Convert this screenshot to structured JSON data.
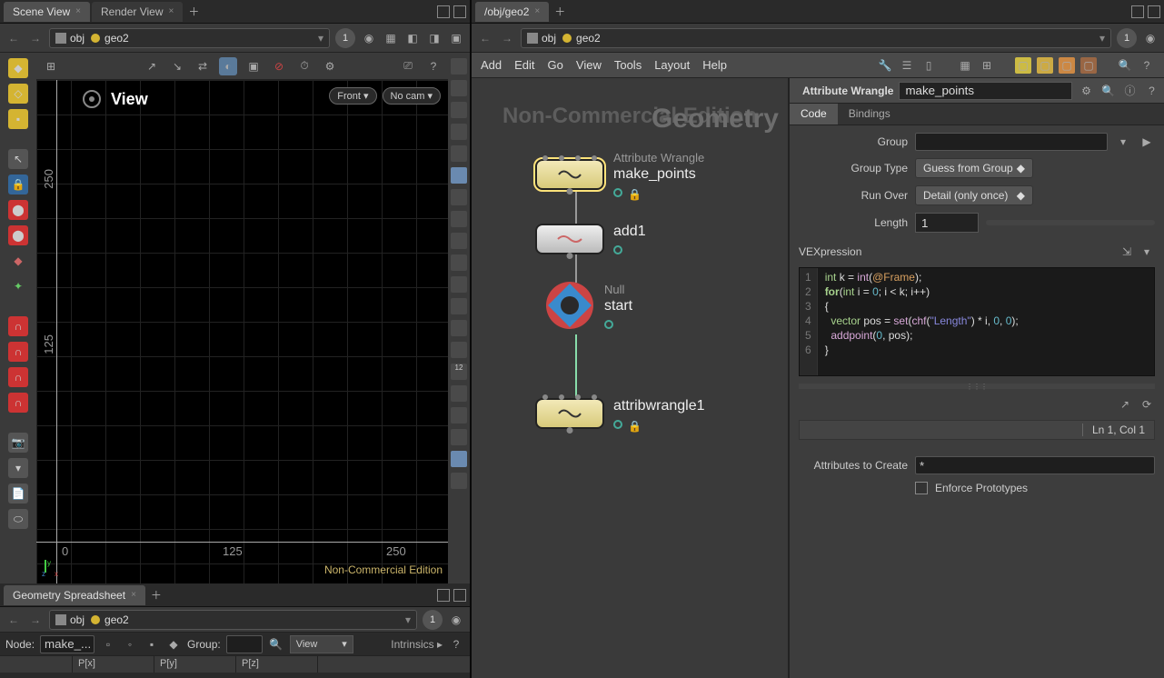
{
  "left": {
    "tabs": [
      {
        "label": "Scene View",
        "active": true
      },
      {
        "label": "Render View",
        "active": false
      }
    ],
    "path": {
      "ctx": "obj",
      "name": "geo2",
      "badge": "1"
    },
    "view": {
      "title": "View",
      "front": "Front",
      "nocam": "No cam",
      "axis": {
        "y125": "125",
        "y250": "250",
        "x0": "0",
        "x125": "125",
        "x250": "250"
      },
      "nce": "Non-Commercial Edition"
    },
    "spreadsheet": {
      "tab": "Geometry Spreadsheet",
      "path": {
        "ctx": "obj",
        "name": "geo2",
        "badge": "1"
      },
      "node_label": "Node:",
      "node_val": "make_...",
      "group_label": "Group:",
      "view_label": "View",
      "intrinsics": "Intrinsics",
      "cols": [
        "P[x]",
        "P[y]",
        "P[z]"
      ]
    }
  },
  "right": {
    "tabs": [
      {
        "label": "/obj/geo2",
        "active": true
      }
    ],
    "path": {
      "ctx": "obj",
      "name": "geo2",
      "badge": "1"
    },
    "menu": [
      "Add",
      "Edit",
      "Go",
      "View",
      "Tools",
      "Layout",
      "Help"
    ],
    "bg_nce": "Non-Commercial Edition",
    "bg_geom": "Geometry",
    "nodes": {
      "wrangle": {
        "type": "Attribute Wrangle",
        "name": "make_points"
      },
      "add": {
        "name": "add1"
      },
      "null": {
        "type": "Null",
        "name": "start"
      },
      "wrangle2": {
        "name": "attribwrangle1"
      }
    }
  },
  "params": {
    "optype": "Attribute Wrangle",
    "name": "make_points",
    "tabs": [
      "Code",
      "Bindings"
    ],
    "group_label": "Group",
    "group_val": "",
    "grouptype_label": "Group Type",
    "grouptype_val": "Guess from Group",
    "runover_label": "Run Over",
    "runover_val": "Detail (only once)",
    "length_label": "Length",
    "length_val": "1",
    "vex_label": "VEXpression",
    "code_ln": [
      "1",
      "2",
      "3",
      "4",
      "5",
      "6"
    ],
    "status": "Ln 1, Col 1",
    "attrs_label": "Attributes to Create",
    "attrs_val": "*",
    "enforce": "Enforce Prototypes"
  }
}
